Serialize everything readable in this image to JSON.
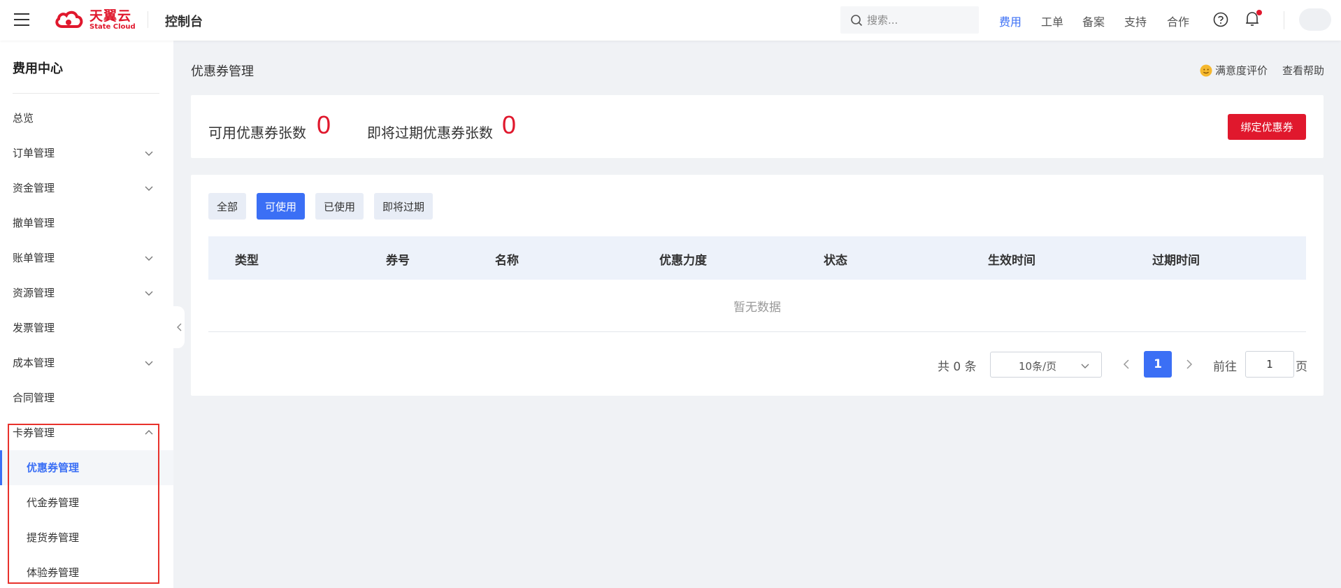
{
  "brand": {
    "name_cn": "天翼云",
    "name_en": "State Cloud",
    "color": "#e0182d"
  },
  "header": {
    "console_title": "控制台",
    "search_placeholder": "搜索...",
    "nav": [
      "费用",
      "工单",
      "备案",
      "支持",
      "合作"
    ],
    "active_nav": "费用",
    "icons": [
      "menu-icon",
      "help-icon",
      "bell-icon",
      "avatar"
    ]
  },
  "sidebar": {
    "title": "费用中心",
    "items": [
      {
        "label": "总览",
        "expandable": false
      },
      {
        "label": "订单管理",
        "expandable": true
      },
      {
        "label": "资金管理",
        "expandable": true
      },
      {
        "label": "撤单管理",
        "expandable": false
      },
      {
        "label": "账单管理",
        "expandable": true
      },
      {
        "label": "资源管理",
        "expandable": true
      },
      {
        "label": "发票管理",
        "expandable": false
      },
      {
        "label": "成本管理",
        "expandable": true
      },
      {
        "label": "合同管理",
        "expandable": false
      },
      {
        "label": "卡券管理",
        "expandable": true,
        "expanded": true
      }
    ],
    "sub_items": [
      "优惠券管理",
      "代金券管理",
      "提货券管理",
      "体验券管理"
    ],
    "active_sub": "优惠券管理"
  },
  "page": {
    "title": "优惠券管理",
    "satisfaction": "满意度评价",
    "help": "查看帮助"
  },
  "stats": {
    "available_label": "可用优惠券张数",
    "available_value": "0",
    "expiring_label": "即将过期优惠券张数",
    "expiring_value": "0",
    "bind_button": "绑定优惠券"
  },
  "filters": {
    "tabs": [
      "全部",
      "可使用",
      "已使用",
      "即将过期"
    ],
    "active": "可使用"
  },
  "table": {
    "columns": [
      "类型",
      "券号",
      "名称",
      "优惠力度",
      "状态",
      "生效时间",
      "过期时间"
    ],
    "rows": [],
    "empty_text": "暂无数据"
  },
  "pagination": {
    "total_text": "共 0 条",
    "page_size": "10条/页",
    "current_page": "1",
    "goto_label": "前往",
    "goto_value": "1",
    "goto_suffix": "页"
  },
  "colors": {
    "accent": "#3b6ff5",
    "danger": "#e0182d"
  }
}
